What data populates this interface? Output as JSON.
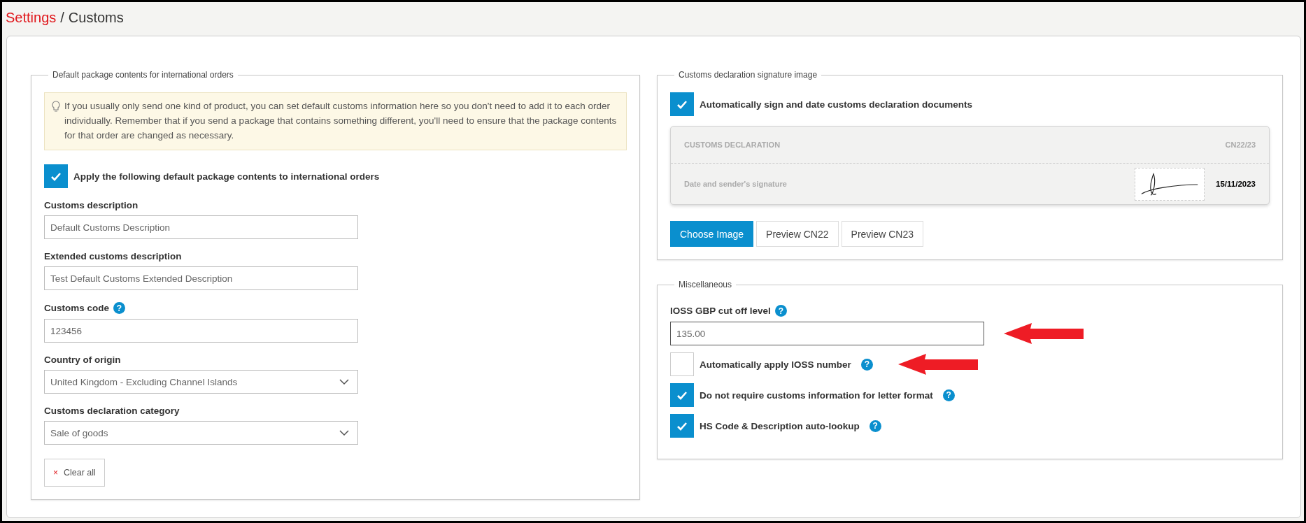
{
  "breadcrumb": {
    "items": [
      {
        "label": "Settings",
        "kind": "link"
      },
      {
        "label": "Customs",
        "kind": "current"
      }
    ],
    "separator": "/"
  },
  "default_package": {
    "legend": "Default package contents for international orders",
    "info": "If you usually only send one kind of product, you can set default customs information here so you don't need to add it to each order individually. Remember that if you send a package that contains something different, you'll need to ensure that the package contents for that order are changed as necessary.",
    "apply": {
      "label": "Apply the following default package contents to international orders",
      "checked": true
    },
    "fields": [
      {
        "label": "Customs description",
        "kind": "text",
        "value": "Default Customs Description"
      },
      {
        "label": "Extended customs description",
        "kind": "text",
        "value": "Test Default Customs Extended Description"
      },
      {
        "label": "Customs code",
        "kind": "text",
        "value": "123456",
        "help": "?"
      },
      {
        "label": "Country of origin",
        "kind": "select",
        "value": "United Kingdom - Excluding Channel Islands"
      },
      {
        "label": "Customs declaration category",
        "kind": "select",
        "value": "Sale of goods"
      }
    ],
    "clear_button": {
      "icon": "×",
      "label": "Clear all"
    }
  },
  "signature": {
    "legend": "Customs declaration signature image",
    "auto_sign": {
      "label": "Automatically sign and date customs declaration documents",
      "checked": true
    },
    "preview": {
      "title": "CUSTOMS DECLARATION",
      "code": "CN22/23",
      "line_label": "Date and sender's signature",
      "date": "15/11/2023"
    },
    "buttons": [
      {
        "label": "Choose Image",
        "kind": "primary"
      },
      {
        "label": "Preview CN22",
        "kind": "default"
      },
      {
        "label": "Preview CN23",
        "kind": "default"
      }
    ]
  },
  "misc": {
    "legend": "Miscellaneous",
    "cutoff": {
      "label": "IOSS GBP cut off level",
      "help": "?",
      "value": "135.00",
      "arrow": true
    },
    "options": [
      {
        "label": "Automatically apply IOSS number",
        "checked": false,
        "help": "?",
        "arrow": true
      },
      {
        "label": "Do not require customs information for letter format",
        "checked": true,
        "help": "?",
        "arrow": false
      },
      {
        "label": "HS Code & Description auto-lookup",
        "checked": true,
        "help": "?",
        "arrow": false
      }
    ]
  }
}
